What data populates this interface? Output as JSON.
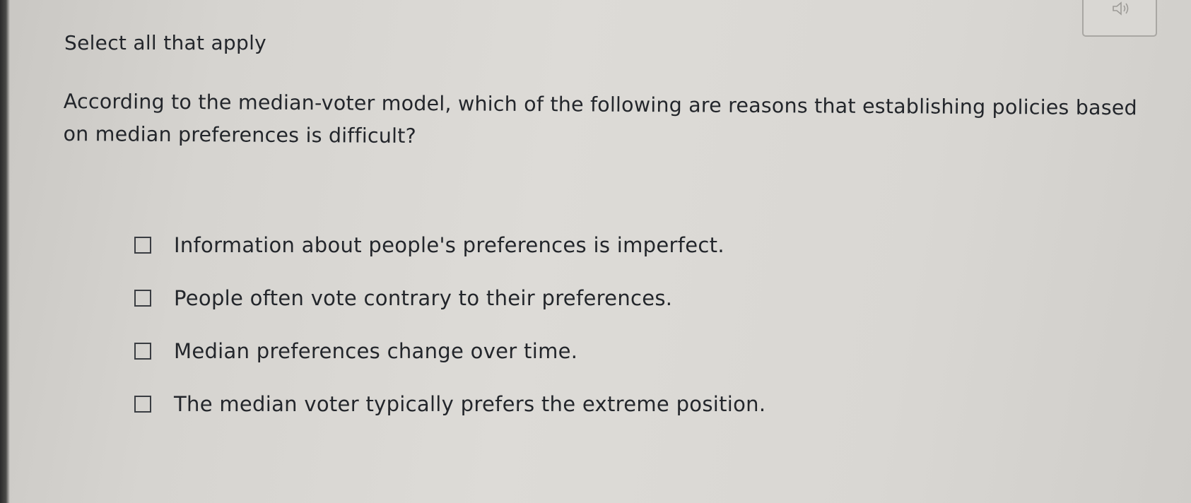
{
  "header": {
    "instruction": "Select all that apply"
  },
  "question": {
    "line1": "According to the median-voter model, which of the following are reasons that establishing policies based",
    "line2": "on median preferences is difficult?"
  },
  "options": [
    {
      "label": "Information about people's preferences is imperfect.",
      "checked": false
    },
    {
      "label": "People often vote contrary to their preferences.",
      "checked": false
    },
    {
      "label": "Median preferences change over time.",
      "checked": false
    },
    {
      "label": "The median voter typically prefers the extreme position.",
      "checked": false
    }
  ],
  "controls": {
    "audio_icon": "speaker-icon"
  }
}
